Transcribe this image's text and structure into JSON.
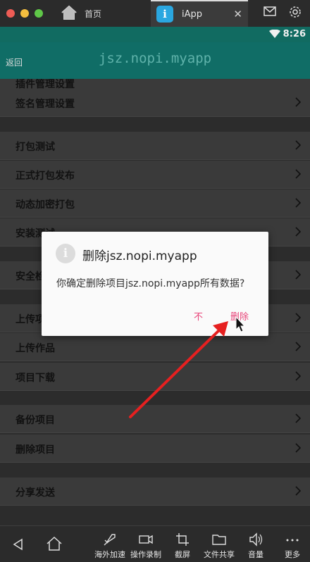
{
  "window": {
    "tabs": [
      {
        "label": "首页",
        "icon": "home-icon"
      },
      {
        "label": "iApp",
        "icon": "iapp-icon",
        "active": true
      }
    ],
    "traffic_colors": [
      "#ee5c55",
      "#f4be3f",
      "#5fc748"
    ]
  },
  "status": {
    "time": "8:26"
  },
  "appbar": {
    "back_label": "返回",
    "title": "jsz.nopi.myapp"
  },
  "list": {
    "items": [
      {
        "label": "插件管理设置"
      },
      {
        "label": "签名管理设置"
      },
      {
        "label": "打包测试"
      },
      {
        "label": "正式打包发布"
      },
      {
        "label": "动态加密打包"
      },
      {
        "label": "安装测试"
      },
      {
        "label": "安全检测"
      },
      {
        "label": "上传项目"
      },
      {
        "label": "上传作品"
      },
      {
        "label": "项目下载"
      },
      {
        "label": "备份项目"
      },
      {
        "label": "删除项目"
      },
      {
        "label": "分享发送"
      }
    ]
  },
  "dialog": {
    "title": "删除jsz.nopi.myapp",
    "message": "你确定删除项目jsz.nopi.myapp所有数据?",
    "cancel_label": "不",
    "confirm_label": "删除"
  },
  "toolbar": {
    "items": [
      {
        "label": "海外加速",
        "icon": "rocket-icon"
      },
      {
        "label": "操作录制",
        "icon": "video-camera-icon"
      },
      {
        "label": "截屏",
        "icon": "crop-icon"
      },
      {
        "label": "文件共享",
        "icon": "folder-icon"
      },
      {
        "label": "音量",
        "icon": "volume-icon"
      },
      {
        "label": "更多",
        "icon": "more-icon"
      }
    ]
  },
  "colors": {
    "accent": "#e8457a",
    "appbar": "#106d66",
    "annotation_arrow": "#e62020"
  }
}
